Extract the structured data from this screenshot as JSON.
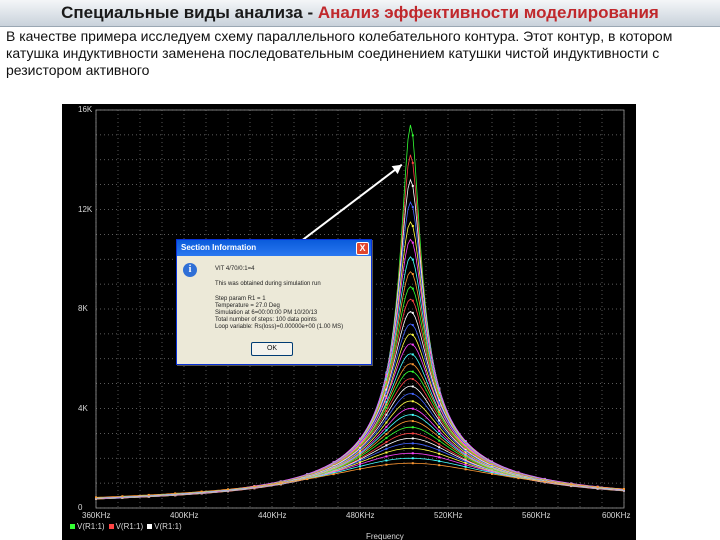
{
  "slide": {
    "title_main": "Специальные виды анализа - ",
    "title_accent": "Анализ эффективности моделирования",
    "description": "В качестве примера исследуем схему параллельного колебательного контура. Этот контур, в котором катушка индуктивности заменена последовательным соединением катушки чистой индуктивности с резистором активного"
  },
  "dialog": {
    "title": "Section Information",
    "close_glyph": "X",
    "info_glyph": "i",
    "lines": [
      "VIT  4/70/0:1=4",
      "This was obtained during simulation run",
      "Step param R1 = 1",
      "Temperature = 27.0 Deg",
      "Simulation at 6=00:00:00 PM 10/20/13",
      "Total number of steps: 100 data points",
      "Loop variable: Rs(loss)=0.00000e+00 (1.00 MS)"
    ],
    "ok_label": "OK"
  },
  "chart_data": {
    "type": "line",
    "ylim": [
      0,
      16000
    ],
    "xlim": [
      360000,
      600000
    ],
    "yticks": [
      "16K",
      "12K",
      "8K",
      "4K",
      "0"
    ],
    "xticks": [
      "360KHz",
      "400KHz",
      "440KHz",
      "480KHz",
      "520KHz",
      "560KHz",
      "600KHz"
    ],
    "xlabel": "Frequency",
    "legend": [
      "V(R1:1)",
      "V(R1:1)",
      "V(R1:1)"
    ],
    "peak_frequency": 503000,
    "series": [
      {
        "color": "#33ff33",
        "peak": 15400,
        "q": 60
      },
      {
        "color": "#ff4444",
        "peak": 14200,
        "q": 55
      },
      {
        "color": "#ffffff",
        "peak": 13200,
        "q": 50
      },
      {
        "color": "#4466ff",
        "peak": 12300,
        "q": 46
      },
      {
        "color": "#ffff44",
        "peak": 11500,
        "q": 43
      },
      {
        "color": "#ff44ff",
        "peak": 10800,
        "q": 40
      },
      {
        "color": "#44ffff",
        "peak": 10100,
        "q": 38
      },
      {
        "color": "#ff9933",
        "peak": 9500,
        "q": 36
      },
      {
        "color": "#33ff33",
        "peak": 8900,
        "q": 34
      },
      {
        "color": "#ff4444",
        "peak": 8400,
        "q": 32
      },
      {
        "color": "#ffffff",
        "peak": 7900,
        "q": 30
      },
      {
        "color": "#4466ff",
        "peak": 7400,
        "q": 28
      },
      {
        "color": "#ffff44",
        "peak": 7000,
        "q": 27
      },
      {
        "color": "#ff44ff",
        "peak": 6600,
        "q": 25
      },
      {
        "color": "#44ffff",
        "peak": 6200,
        "q": 24
      },
      {
        "color": "#ff9933",
        "peak": 5800,
        "q": 22
      },
      {
        "color": "#33ff33",
        "peak": 5500,
        "q": 21
      },
      {
        "color": "#ff4444",
        "peak": 5200,
        "q": 20
      },
      {
        "color": "#ffffff",
        "peak": 4900,
        "q": 19
      },
      {
        "color": "#4466ff",
        "peak": 4600,
        "q": 18
      },
      {
        "color": "#ffff44",
        "peak": 4300,
        "q": 17
      },
      {
        "color": "#ff44ff",
        "peak": 4000,
        "q": 16
      },
      {
        "color": "#44ffff",
        "peak": 3750,
        "q": 15
      },
      {
        "color": "#ff9933",
        "peak": 3500,
        "q": 14
      },
      {
        "color": "#33ff33",
        "peak": 3250,
        "q": 13
      },
      {
        "color": "#ff4444",
        "peak": 3000,
        "q": 12
      },
      {
        "color": "#ffffff",
        "peak": 2800,
        "q": 11
      },
      {
        "color": "#4466ff",
        "peak": 2600,
        "q": 10
      },
      {
        "color": "#ffff44",
        "peak": 2400,
        "q": 9
      },
      {
        "color": "#ff44ff",
        "peak": 2200,
        "q": 8
      },
      {
        "color": "#44ffff",
        "peak": 2000,
        "q": 7
      },
      {
        "color": "#ff9933",
        "peak": 1800,
        "q": 6
      }
    ],
    "annotation_arrow": {
      "from_freq": 420000,
      "from_value": 8500,
      "to_freq": 499000,
      "to_value": 13800
    }
  }
}
